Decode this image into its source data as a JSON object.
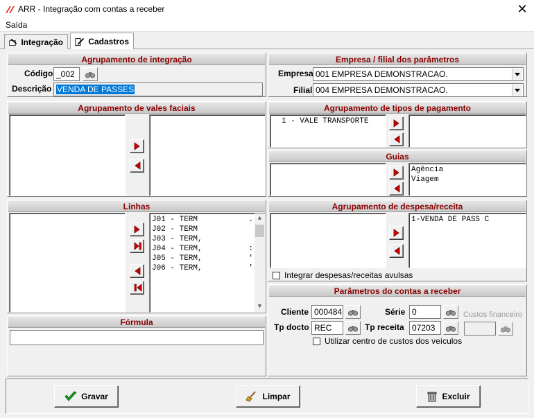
{
  "window": {
    "title": "ARR - Integração com contas a receber",
    "close_glyph": "✕"
  },
  "menu": {
    "saida": "Saída"
  },
  "tabs": [
    {
      "label": "Integração"
    },
    {
      "label": "Cadastros"
    }
  ],
  "agrupamento_integracao": {
    "heading": "Agrupamento de integração",
    "codigo_label": "Código",
    "codigo_value": "_002",
    "descricao_label": "Descrição",
    "descricao_value": "VENDA DE PASSES"
  },
  "empresa_filial": {
    "heading": "Empresa / filial  dos parâmetros",
    "empresa_label": "Empresa",
    "empresa_value": "001 EMPRESA DEMONSTRACAO.",
    "filial_label": "Filial",
    "filial_value": "004 EMPRESA DEMONSTRACAO."
  },
  "vales_faciais": {
    "heading": "Agrupamento de vales faciais"
  },
  "tipos_pagamento": {
    "heading": "Agrupamento de tipos de pagamento",
    "left_items": [
      "1 - VALE TRANSPORTE"
    ]
  },
  "guias": {
    "heading": "Guias",
    "right_items": [
      "Agência",
      "Viagem"
    ]
  },
  "linhas": {
    "heading": "Linhas",
    "right_items": [
      "J01 - TERM",
      "J02 - TERM",
      "J03 - TERM,",
      "J04 - TERM,",
      "J05 - TERM,",
      "J06 - TERM,"
    ],
    "trail": [
      ".",
      "",
      "",
      ":",
      "'",
      "'"
    ]
  },
  "despesa_receita": {
    "heading": "Agrupamento de despesa/receita",
    "right_items": [
      "1-VENDA DE PASS C"
    ],
    "checkbox_label": "Integrar despesas/receitas avulsas"
  },
  "formula": {
    "heading": "Fórmula",
    "value": ""
  },
  "parametros": {
    "heading": "Parâmetros do contas a receber",
    "cliente_label": "Cliente",
    "cliente_value": "000484",
    "serie_label": "Série",
    "serie_value": "0",
    "custos_label": "Custos financeiro",
    "custos_value": "",
    "tpdocto_label": "Tp docto",
    "tpdocto_value": "REC",
    "tpreceita_label": "Tp receita",
    "tpreceita_value": "07203",
    "checkbox_label": "Utilizar centro de custos dos veículos"
  },
  "buttons": {
    "gravar": "Gravar",
    "limpar": "Limpar",
    "excluir": "Excluir"
  },
  "colors": {
    "heading": "#8b0000",
    "arrow": "#d00000",
    "selection": "#0078d7"
  }
}
